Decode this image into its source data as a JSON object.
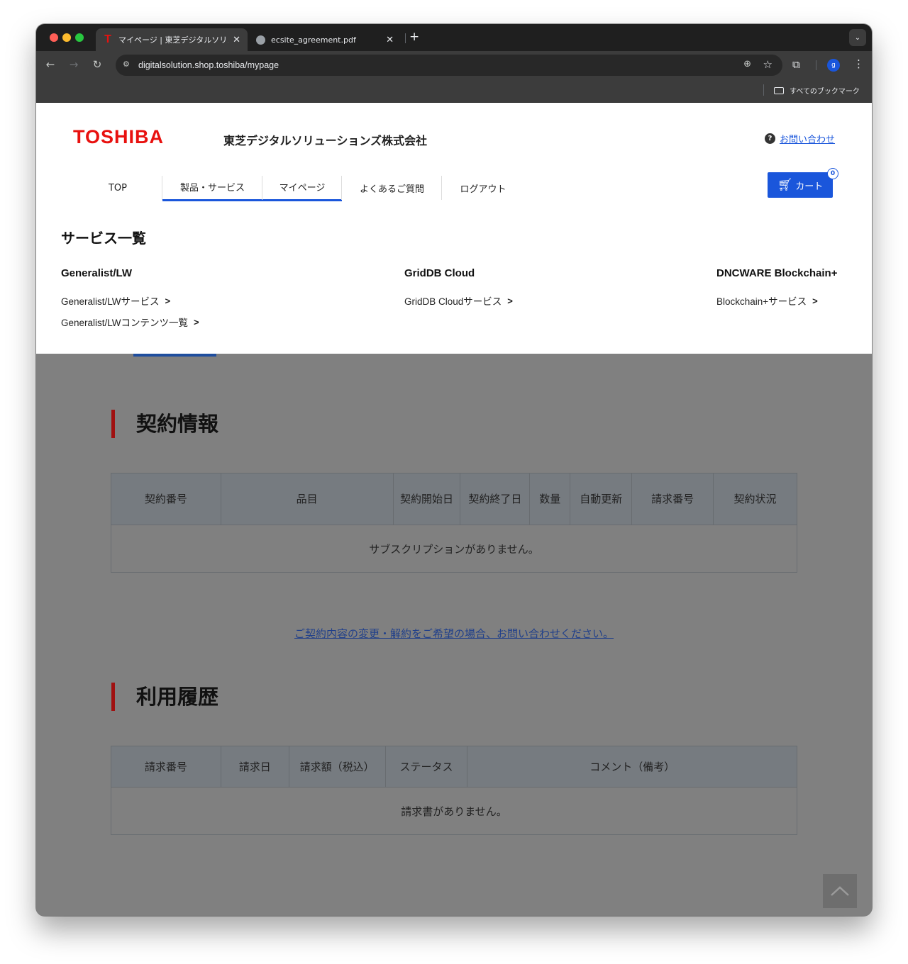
{
  "browser": {
    "tabs": [
      {
        "title": "マイページ | 東芝デジタルソリュ",
        "active": true,
        "favicon": "T"
      },
      {
        "title": "ecsite_agreement.pdf",
        "active": false
      }
    ],
    "url": "digitalsolution.shop.toshiba/mypage",
    "bookmarks_label": "すべてのブックマーク",
    "profile_initial": "g"
  },
  "header": {
    "logo": "TOSHIBA",
    "company": "東芝デジタルソリューションズ株式会社",
    "contact_label": "お問い合わせ",
    "nav": [
      {
        "label": "TOP"
      },
      {
        "label": "製品・サービス"
      },
      {
        "label": "マイページ"
      },
      {
        "label": "よくあるご質問"
      },
      {
        "label": "ログアウト"
      }
    ],
    "cart_label": "カート",
    "cart_count": "0"
  },
  "services": {
    "title": "サービス一覧",
    "columns": [
      {
        "heading": "Generalist/LW",
        "links": [
          "Generalist/LWサービス",
          "Generalist/LWコンテンツ一覧"
        ]
      },
      {
        "heading": "GridDB Cloud",
        "links": [
          "GridDB Cloudサービス"
        ]
      },
      {
        "heading": "DNCWARE Blockchain+",
        "links": [
          "Blockchain+サービス"
        ]
      }
    ]
  },
  "contract": {
    "title": "契約情報",
    "headers": [
      "契約番号",
      "品目",
      "契約開始日",
      "契約終了日",
      "数量",
      "自動更新",
      "請求番号",
      "契約状況"
    ],
    "empty_message": "サブスクリプションがありません。",
    "notice": "ご契約内容の変更・解約をご希望の場合、お問い合わせください。"
  },
  "usage": {
    "title": "利用履歴",
    "headers": [
      "請求番号",
      "請求日",
      "請求額（税込）",
      "ステータス",
      "コメント（備考）"
    ],
    "empty_message": "請求書がありません。"
  },
  "colors": {
    "brand_red": "#e8110f",
    "accent_blue": "#1a56db",
    "section_bar": "#a01010"
  }
}
